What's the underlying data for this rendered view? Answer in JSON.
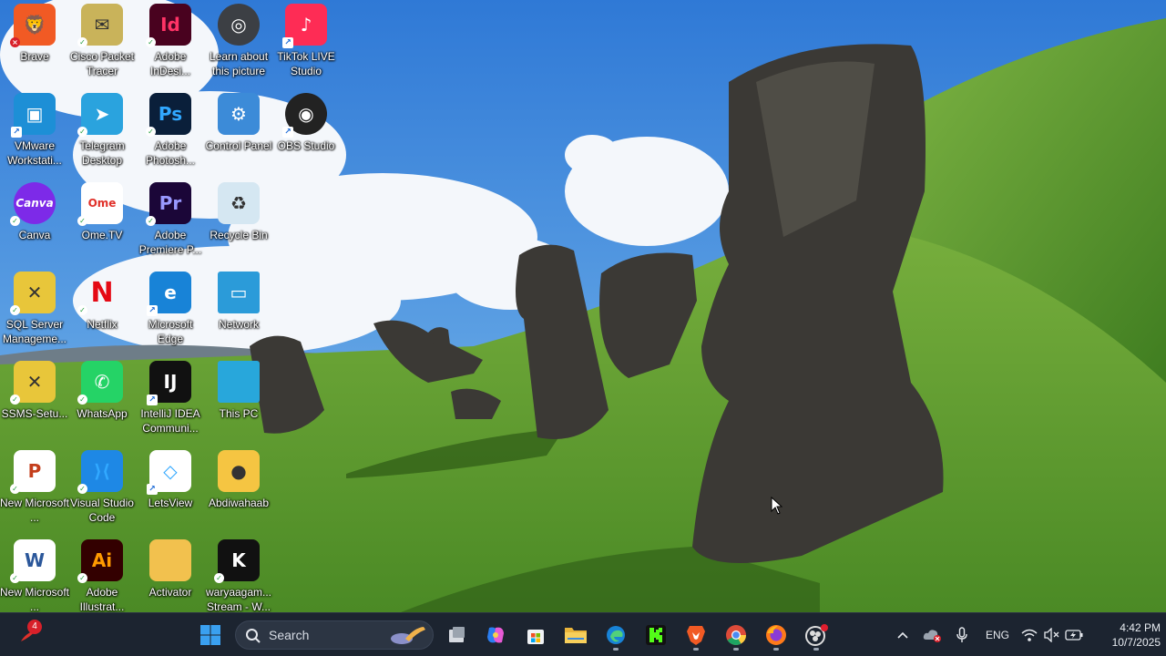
{
  "desktop": {
    "icons": [
      {
        "id": "brave",
        "label": "Brave",
        "glyph": "brave-lion",
        "color": "#f15a24",
        "text": "🦁",
        "badge": "x"
      },
      {
        "id": "cisco",
        "label": "Cisco Packet Tracer",
        "glyph": "packet-tracer",
        "color": "#c9b35a",
        "text": "✉",
        "badge": "check"
      },
      {
        "id": "indesign",
        "label": "Adobe InDesi...",
        "glyph": "indesign",
        "color": "#49021f",
        "text": "Id",
        "badge": "check"
      },
      {
        "id": "learn",
        "label": "Learn about this picture",
        "glyph": "camera-circle",
        "color": "#3c3f44",
        "text": "◎",
        "badge": "none"
      },
      {
        "id": "tiktok",
        "label": "TikTok LIVE Studio",
        "glyph": "tiktok-live",
        "color": "#fe2c55",
        "text": "♪",
        "badge": "link"
      },
      {
        "id": "vmware",
        "label": "VMware Workstati...",
        "glyph": "vmware",
        "color": "#1d8fd6",
        "text": "▣",
        "badge": "link"
      },
      {
        "id": "telegram",
        "label": "Telegram Desktop",
        "glyph": "telegram",
        "color": "#2aa3de",
        "text": "➤",
        "badge": "check"
      },
      {
        "id": "photoshop",
        "label": "Adobe Photosh...",
        "glyph": "photoshop",
        "color": "#0a1f3a",
        "text": "Ps",
        "badge": "check"
      },
      {
        "id": "control",
        "label": "Control Panel",
        "glyph": "control-panel",
        "color": "#3c8bd8",
        "text": "⚙",
        "badge": "none"
      },
      {
        "id": "obs",
        "label": "OBS Studio",
        "glyph": "obs",
        "color": "#222",
        "text": "◉",
        "badge": "link"
      },
      {
        "id": "canva",
        "label": "Canva",
        "glyph": "canva",
        "color": "#7d2ae8",
        "text": "Canva",
        "badge": "check"
      },
      {
        "id": "ometv",
        "label": "Ome.TV",
        "glyph": "ome-tv",
        "color": "#ffffff",
        "text": "Ome",
        "badge": "check"
      },
      {
        "id": "premiere",
        "label": "Adobe Premiere P...",
        "glyph": "premiere",
        "color": "#1b0638",
        "text": "Pr",
        "badge": "check"
      },
      {
        "id": "recycle",
        "label": "Recycle Bin",
        "glyph": "recycle-bin",
        "color": "#d5e7f2",
        "text": "♻",
        "badge": "none"
      },
      {
        "id": "sqlserver",
        "label": "SQL Server Manageme...",
        "glyph": "sql-server",
        "color": "#e8c63a",
        "text": "✕",
        "badge": "check"
      },
      {
        "id": "netflix",
        "label": "Netflix",
        "glyph": "netflix",
        "color": "#111",
        "text": "N",
        "badge": "check"
      },
      {
        "id": "edge",
        "label": "Microsoft Edge",
        "glyph": "edge",
        "color": "#1883d7",
        "text": "e",
        "badge": "link"
      },
      {
        "id": "network",
        "label": "Network",
        "glyph": "network",
        "color": "#2b9bd9",
        "text": "▭",
        "badge": "none"
      },
      {
        "id": "ssms",
        "label": "SSMS-Setu...",
        "glyph": "ssms-setup",
        "color": "#e8c63a",
        "text": "✕",
        "badge": "check"
      },
      {
        "id": "whatsapp",
        "label": "WhatsApp",
        "glyph": "whatsapp",
        "color": "#25d366",
        "text": "✆",
        "badge": "check"
      },
      {
        "id": "intellij",
        "label": "IntelliJ IDEA Communi...",
        "glyph": "intellij",
        "color": "#111",
        "text": "IJ",
        "badge": "link"
      },
      {
        "id": "thispc",
        "label": "This PC",
        "glyph": "monitor",
        "color": "#28a7db",
        "text": "",
        "badge": "none"
      },
      {
        "id": "newppt",
        "label": "New Microsoft ...",
        "glyph": "powerpoint-file",
        "color": "#ffffff",
        "text": "P",
        "badge": "check"
      },
      {
        "id": "vscode",
        "label": "Visual Studio Code",
        "glyph": "vscode",
        "color": "#1e88e5",
        "text": "⟩⟨",
        "badge": "check"
      },
      {
        "id": "letsview",
        "label": "LetsView",
        "glyph": "letsview",
        "color": "#ffffff",
        "text": "◇",
        "badge": "link"
      },
      {
        "id": "abdiwahaab",
        "label": "Abdiwahaab",
        "glyph": "user-folder",
        "color": "#f5c542",
        "text": "●",
        "badge": "none"
      },
      {
        "id": "newword",
        "label": "New Microsoft ...",
        "glyph": "word-file",
        "color": "#ffffff",
        "text": "W",
        "badge": "check"
      },
      {
        "id": "illustrator",
        "label": "Adobe Illustrat...",
        "glyph": "illustrator",
        "color": "#300",
        "text": "Ai",
        "badge": "check"
      },
      {
        "id": "activator",
        "label": "Activator",
        "glyph": "folder",
        "color": "#f2c14e",
        "text": "",
        "badge": "none"
      },
      {
        "id": "waryaagam",
        "label": "waryaagam... Stream - W...",
        "glyph": "kick",
        "color": "#111",
        "text": "K",
        "badge": "check"
      }
    ]
  },
  "taskbar": {
    "notification_count": "4",
    "search_placeholder": "Search",
    "pinned": [
      {
        "id": "start",
        "name": "windows-start-icon",
        "color": "#3aa0f0"
      },
      {
        "id": "taskview",
        "name": "task-view-icon",
        "color": "#c9ced6"
      },
      {
        "id": "copilot",
        "name": "copilot-icon",
        "color": "#6b5cf5"
      },
      {
        "id": "store",
        "name": "microsoft-store-icon",
        "color": "#ffffff"
      },
      {
        "id": "explorer",
        "name": "file-explorer-icon",
        "color": "#f4c23c"
      },
      {
        "id": "edge",
        "name": "edge-icon",
        "color": "#1883d7"
      },
      {
        "id": "kick",
        "name": "kick-icon",
        "color": "#53fc18"
      },
      {
        "id": "brave",
        "name": "brave-icon",
        "color": "#f15a24"
      },
      {
        "id": "chrome",
        "name": "chrome-icon",
        "color": "#dd4b39"
      },
      {
        "id": "firefox",
        "name": "firefox-icon",
        "color": "#ff7a1a"
      },
      {
        "id": "obs",
        "name": "obs-icon",
        "color": "#dddddd"
      }
    ],
    "tray": {
      "language": "ENG",
      "time": "4:42 PM",
      "date": "10/7/2025"
    }
  }
}
